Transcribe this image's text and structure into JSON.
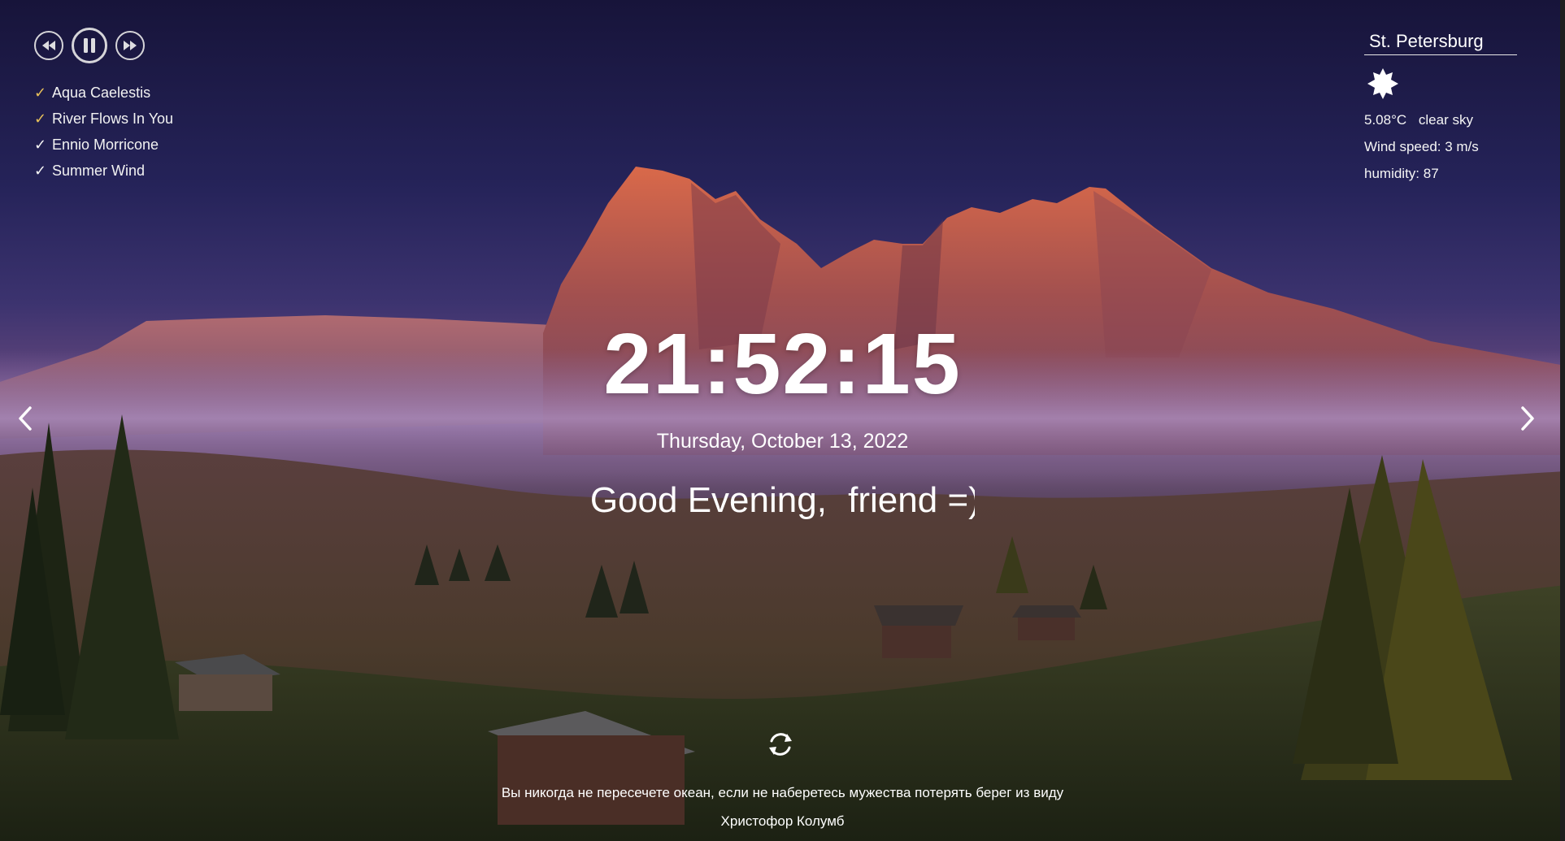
{
  "player": {
    "controls": {
      "prev_icon": "rewind-icon",
      "play_icon": "pause-icon",
      "next_icon": "fast-forward-icon"
    },
    "playlist": [
      {
        "title": "Aqua Caelestis",
        "active": true
      },
      {
        "title": "River Flows In You",
        "active": true
      },
      {
        "title": "Ennio Morricone",
        "active": false
      },
      {
        "title": "Summer Wind",
        "active": false
      }
    ]
  },
  "weather": {
    "city": "St. Petersburg",
    "icon": "clear-day-icon",
    "temperature": "5.08°C",
    "description": "clear sky",
    "wind": "Wind speed: 3 m/s",
    "humidity": "humidity: 87"
  },
  "clock": {
    "time": "21:52:15",
    "date": "Thursday, October 13, 2022"
  },
  "greeting": {
    "text": "Good Evening, ",
    "name": "friend =)"
  },
  "quote": {
    "text": "Вы никогда не пересечете океан, если не наберетесь мужества потерять берег из виду",
    "author": "Христофор Колумб",
    "refresh_icon": "refresh-icon"
  },
  "slider": {
    "prev_icon": "chevron-left-icon",
    "next_icon": "chevron-right-icon"
  },
  "colors": {
    "active_track_check": "#e8c15a",
    "text": "#ffffff"
  }
}
